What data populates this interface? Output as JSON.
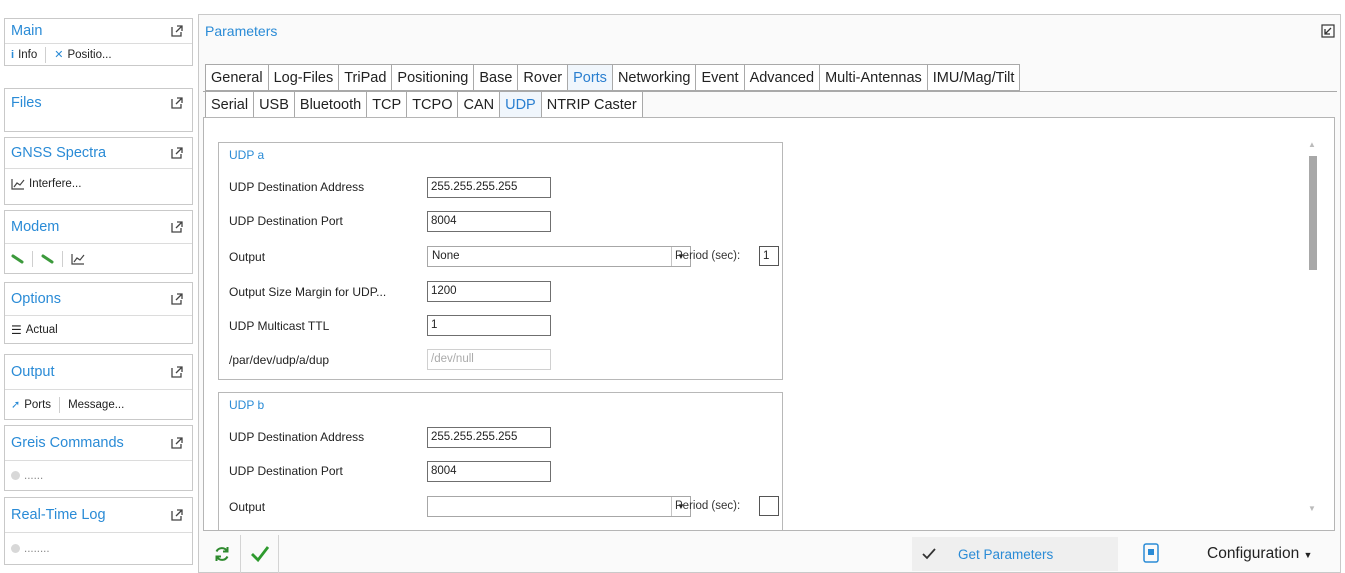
{
  "sidebar": [
    {
      "title": "Main",
      "items": [
        {
          "icon": "info-icon",
          "label": "Info"
        },
        {
          "icon": "satellite-icon",
          "label": "Positio..."
        }
      ]
    },
    {
      "title": "Files",
      "items": []
    },
    {
      "title": "GNSS Spectra",
      "items": [
        {
          "icon": "chart-icon",
          "label": "Interfere..."
        }
      ]
    },
    {
      "title": "Modem",
      "items": [
        {
          "icon": "link-icon"
        },
        {
          "icon": "link-icon"
        },
        {
          "icon": "chart-icon"
        }
      ]
    },
    {
      "title": "Options",
      "items": [
        {
          "icon": "list-icon",
          "label": "Actual"
        }
      ]
    },
    {
      "title": "Output",
      "items": [
        {
          "icon": "arrow-icon",
          "label": "Ports"
        },
        {
          "label": "Message..."
        }
      ]
    },
    {
      "title": "Greis Commands",
      "items": [
        {
          "icon": "status-dot-icon",
          "label": "......"
        }
      ]
    },
    {
      "title": "Real-Time Log",
      "items": [
        {
          "icon": "status-dot-icon",
          "label": "........"
        }
      ]
    }
  ],
  "main": {
    "title": "Parameters",
    "tabs": [
      "General",
      "Log-Files",
      "TriPad",
      "Positioning",
      "Base",
      "Rover",
      "Ports",
      "Networking",
      "Event",
      "Advanced",
      "Multi-Antennas",
      "IMU/Mag/Tilt"
    ],
    "active_tab": "Ports",
    "subtabs": [
      "Serial",
      "USB",
      "Bluetooth",
      "TCP",
      "TCPO",
      "CAN",
      "UDP",
      "NTRIP Caster"
    ],
    "active_subtab": "UDP",
    "udp_a": {
      "title": "UDP a",
      "dest_address_label": "UDP Destination Address",
      "dest_address": "255.255.255.255",
      "dest_port_label": "UDP Destination Port",
      "dest_port": "8004",
      "output_label": "Output",
      "output": "None",
      "period_label": "Period (sec):",
      "period": "1",
      "size_margin_label": "Output Size Margin for UDP...",
      "size_margin": "1200",
      "ttl_label": "UDP Multicast TTL",
      "ttl": "1",
      "dup_label": "/par/dev/udp/a/dup",
      "dup_value": "/dev/null"
    },
    "udp_b": {
      "title": "UDP b",
      "dest_address_label": "UDP Destination Address",
      "dest_address": "255.255.255.255",
      "dest_port_label": "UDP Destination Port",
      "dest_port": "8004",
      "output_label": "Output",
      "output": "",
      "period_label": "Period (sec):",
      "period": ""
    }
  },
  "bottom": {
    "get_parameters": "Get Parameters",
    "configuration": "Configuration"
  },
  "colors": {
    "accent": "#2a8bd6",
    "check": "#2e9a2e",
    "link": "#3c9a3c"
  }
}
